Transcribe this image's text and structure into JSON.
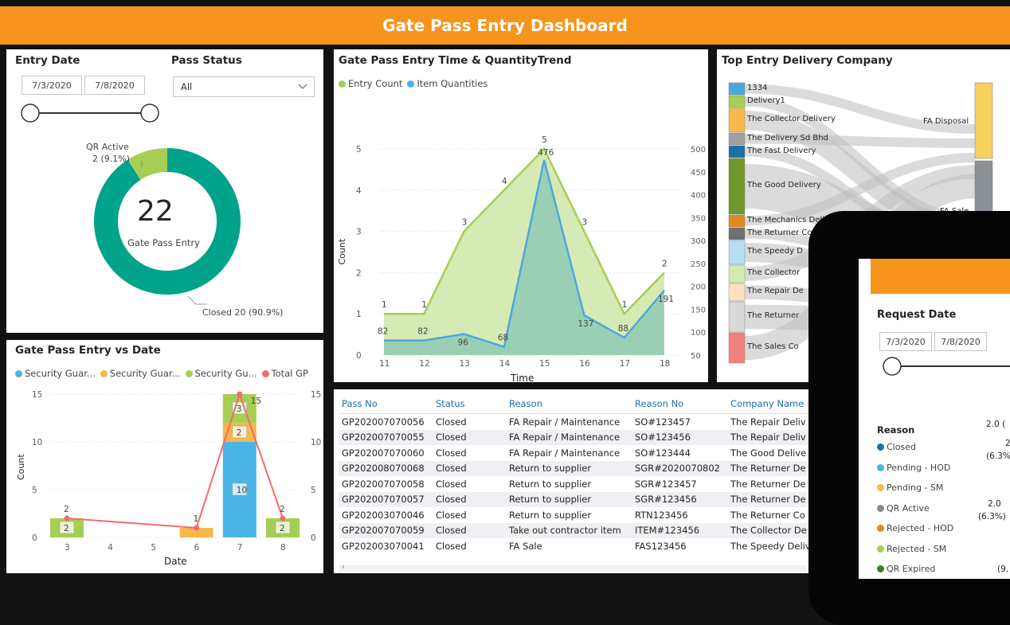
{
  "header": {
    "title": "Gate Pass Entry Dashboard"
  },
  "entry_date": {
    "title": "Entry Date",
    "start": "7/3/2020",
    "end": "7/8/2020"
  },
  "pass_status": {
    "title": "Pass Status",
    "selected": "All"
  },
  "donut": {
    "total": "22",
    "center_label": "Gate Pass Entry",
    "qr_label": "QR Active",
    "qr_value": "2 (9.1%)",
    "closed_label": "Closed 20 (90.9%)",
    "colors": {
      "closed": "#01a38b",
      "qr": "#a6ce55"
    },
    "fraction_qr": 0.091
  },
  "trend_chart": {
    "title": "Gate Pass Entry Time & QuantityTrend",
    "legend": [
      "Entry Count",
      "Item Quantities"
    ],
    "ylabel": "Count",
    "xlabel": "Time",
    "left_ticks": [
      "0",
      "1",
      "2",
      "3",
      "4",
      "5"
    ],
    "right_ticks": [
      "50",
      "100",
      "150",
      "200",
      "250",
      "300",
      "350",
      "400",
      "450",
      "500"
    ],
    "x_ticks": [
      "11",
      "12",
      "13",
      "14",
      "15",
      "16",
      "17",
      "18"
    ],
    "count_labels": [
      "1",
      "1",
      "3",
      "4",
      "5",
      "3",
      "1",
      "2"
    ],
    "qty_labels": [
      "82",
      "82",
      "96",
      "68",
      "476",
      "137",
      "88",
      "191"
    ]
  },
  "chart_data": [
    {
      "type": "area",
      "title": "Gate Pass Entry Time & QuantityTrend",
      "xlabel": "Time",
      "ylabel": "Count",
      "x": [
        11,
        12,
        13,
        14,
        15,
        16,
        17,
        18
      ],
      "series": [
        {
          "name": "Entry Count",
          "axis": "left",
          "values": [
            1,
            1,
            3,
            4,
            5,
            3,
            1,
            2
          ],
          "color": "#a6ce55"
        },
        {
          "name": "Item Quantities",
          "axis": "right",
          "values": [
            82,
            82,
            96,
            68,
            476,
            137,
            88,
            191
          ],
          "color": "#4da8da"
        }
      ],
      "ylim_left": [
        0,
        5
      ],
      "ylim_right": [
        50,
        500
      ],
      "legend_placement": "top-left"
    },
    {
      "type": "bar",
      "title": "Gate Pass Entry vs Date",
      "xlabel": "Date",
      "ylabel": "Count",
      "categories": [
        "3",
        "4",
        "5",
        "6",
        "7",
        "8"
      ],
      "series": [
        {
          "name": "Security Guar...",
          "values": [
            0,
            0,
            0,
            0,
            10,
            0
          ],
          "color": "#4bb4e6"
        },
        {
          "name": "Security Guar...",
          "values": [
            0,
            0,
            0,
            1,
            2,
            0
          ],
          "color": "#f6b94a"
        },
        {
          "name": "Security Gu...",
          "values": [
            2,
            0,
            0,
            0,
            3,
            2
          ],
          "color": "#a6ce55"
        },
        {
          "name": "Total GP",
          "values": [
            2,
            null,
            null,
            1,
            15,
            2
          ],
          "color": "#f46b6b",
          "line": true
        }
      ],
      "ylim": [
        0,
        15
      ],
      "legend_placement": "top-left"
    }
  ],
  "date_chart": {
    "title": "Gate Pass Entry vs Date",
    "legend": [
      "Security Guar...",
      "Security Guar...",
      "Security Gu...",
      "Total GP"
    ],
    "ylabel": "Count",
    "xlabel": "Date",
    "y_ticks": [
      "0",
      "5",
      "10",
      "15"
    ],
    "x_ticks": [
      "3",
      "4",
      "5",
      "6",
      "7",
      "8"
    ],
    "labels": {
      "d3_bar": "2",
      "d3_top": "2",
      "d6_top": "1",
      "d7_a": "10",
      "d7_b": "2",
      "d7_c": "3",
      "d7_total": "15",
      "d8_bar": "2",
      "d8_top": "2"
    }
  },
  "sankey": {
    "title": "Top Entry Delivery Company",
    "nodes": [
      {
        "label": "1334",
        "color": "#4da8da"
      },
      {
        "label": "Delivery1",
        "color": "#a6ce55"
      },
      {
        "label": "The Collector Delivery",
        "color": "#f6b94a"
      },
      {
        "label": "The Delivery Sd Bhd",
        "color": "#a0a0a0"
      },
      {
        "label": "The Fast Delivery",
        "color": "#1f6fa8"
      },
      {
        "label": "The Good Delivery",
        "color": "#6f9a2b"
      },
      {
        "label": "The Mechanics Deli",
        "color": "#e08a1e"
      },
      {
        "label": "The Returner Co",
        "color": "#707070"
      },
      {
        "label": "The Speedy D",
        "color": "#b4def5"
      },
      {
        "label": "The Collector",
        "color": "#d2ebb0"
      },
      {
        "label": "The Repair De",
        "color": "#fbe1c0"
      },
      {
        "label": "The Returner",
        "color": "#d8d8d8"
      },
      {
        "label": "The Sales Co",
        "color": "#f08080"
      }
    ],
    "targets": [
      "FA Disposal",
      "FA Sale"
    ]
  },
  "table": {
    "columns": [
      "Pass No",
      "Status",
      "Reason",
      "Reason No",
      "Company Name"
    ],
    "rows": [
      [
        "GP202007070056",
        "Closed",
        "FA Repair / Maintenance",
        "SO#123457",
        "The Repair Deliv"
      ],
      [
        "GP202007070055",
        "Closed",
        "FA Repair / Maintenance",
        "SO#123456",
        "The Repair Deliv"
      ],
      [
        "GP202007070060",
        "Closed",
        "FA Repair / Maintenance",
        "SO#123444",
        "The Good Delive"
      ],
      [
        "GP202008070068",
        "Closed",
        "Return to supplier",
        "SGR#2020070802",
        "The Returner De"
      ],
      [
        "GP202007070058",
        "Closed",
        "Return to supplier",
        "SGR#123457",
        "The Returner De"
      ],
      [
        "GP202007070057",
        "Closed",
        "Return to supplier",
        "SGR#123456",
        "The Returner De"
      ],
      [
        "GP202003070046",
        "Closed",
        "Return to supplier",
        "RTN123456",
        "The Returner Co"
      ],
      [
        "GP202007070059",
        "Closed",
        "Take out contractor item",
        "ITEM#123456",
        "The Collector De"
      ],
      [
        "GP202003070041",
        "Closed",
        "FA Sale",
        "FAS123456",
        "The Speedy Deliv"
      ]
    ]
  },
  "phone": {
    "request_date_title": "Request Date",
    "start": "7/3/2020",
    "end": "7/8/2020",
    "reason_title": "Reason",
    "reasons": [
      {
        "label": "Closed",
        "color": "#1f6fa8"
      },
      {
        "label": "Pending - HOD",
        "color": "#4bb4e6"
      },
      {
        "label": "Pending - SM",
        "color": "#f6b94a"
      },
      {
        "label": "QR Active",
        "color": "#8a8a8a"
      },
      {
        "label": "Rejected - HOD",
        "color": "#e08a1e"
      },
      {
        "label": "Rejected - SM",
        "color": "#a6ce55"
      },
      {
        "label": "QR Expired",
        "color": "#3e7a2b"
      }
    ],
    "values": [
      "2.0 (",
      "2",
      "(6.3%",
      "2.0",
      "(6.3%)",
      "(9."
    ]
  }
}
